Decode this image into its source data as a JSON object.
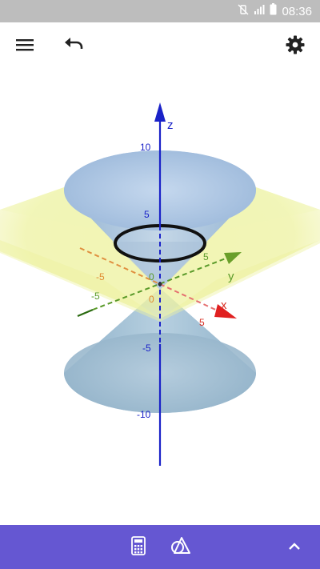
{
  "status_bar": {
    "time": "08:36",
    "icons": [
      "mute-vibrate-icon",
      "signal-icon",
      "battery-icon"
    ]
  },
  "toolbar": {
    "menu_icon": "menu-icon",
    "undo_icon": "undo-icon",
    "settings_icon": "gear-icon"
  },
  "graph": {
    "axes": {
      "z_label": "z",
      "x_label": "x",
      "y_label": "y",
      "z_ticks": [
        "10",
        "5",
        "-5",
        "-10"
      ],
      "x_ticks": [
        "-5",
        "0",
        "5"
      ],
      "y_ticks": [
        "-5",
        "0",
        "5"
      ],
      "origin": "0"
    },
    "colors": {
      "z_axis": "#1a22c8",
      "x_axis": "#d93025",
      "y_axis": "#3a8a1a",
      "cone": "#9fc0dc",
      "plane": "#eef2a0",
      "ellipse": "#111111"
    }
  },
  "bottom_bar": {
    "background": "#6557d2",
    "icons": [
      "calculator-icon",
      "geometry-tools-icon",
      "chevron-up-icon"
    ]
  }
}
